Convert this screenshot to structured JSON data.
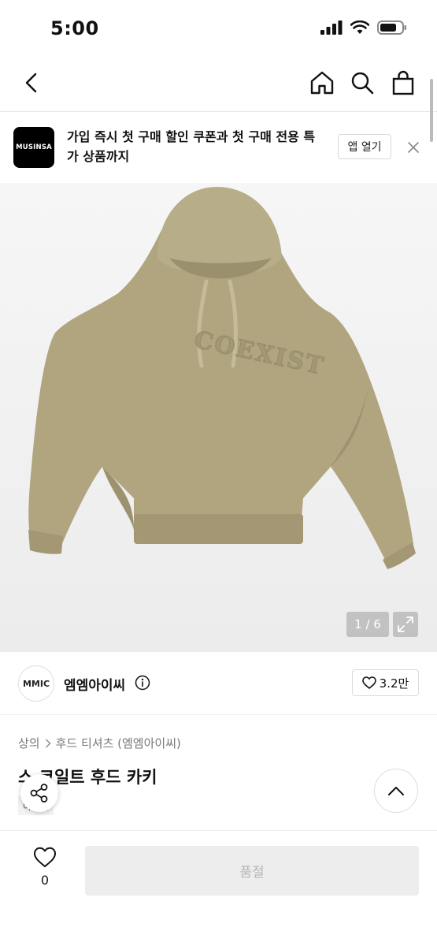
{
  "status": {
    "time": "5:00"
  },
  "promo": {
    "logo_text": "MUSINSA",
    "message": "가입 즉시 첫 구매 할인 쿠폰과 첫 구매 전용 특가 상품까지",
    "open_label": "앱 열기"
  },
  "gallery": {
    "counter": "1 / 6",
    "image_text": "COEXIST"
  },
  "brand": {
    "logo_text": "MMIC",
    "name": "엠엠아이씨",
    "likes": "3.2만"
  },
  "product": {
    "breadcrumb": [
      "상의",
      "후드 티셔츠 (엠엠아이씨)"
    ],
    "title": "스 코일트 후드 카키",
    "tag": "아울렛"
  },
  "bottom": {
    "wish_count": "0",
    "action_label": "품절"
  },
  "icons": [
    "back-icon",
    "home-icon",
    "search-icon",
    "bag-icon",
    "close-icon",
    "expand-icon",
    "info-icon",
    "heart-icon",
    "share-icon",
    "chevron-up-icon",
    "chevron-right-icon"
  ],
  "colors": {
    "hoodie": "#b0a57f",
    "soldout_bg": "#ededed",
    "soldout_text": "#b5b5b5"
  }
}
